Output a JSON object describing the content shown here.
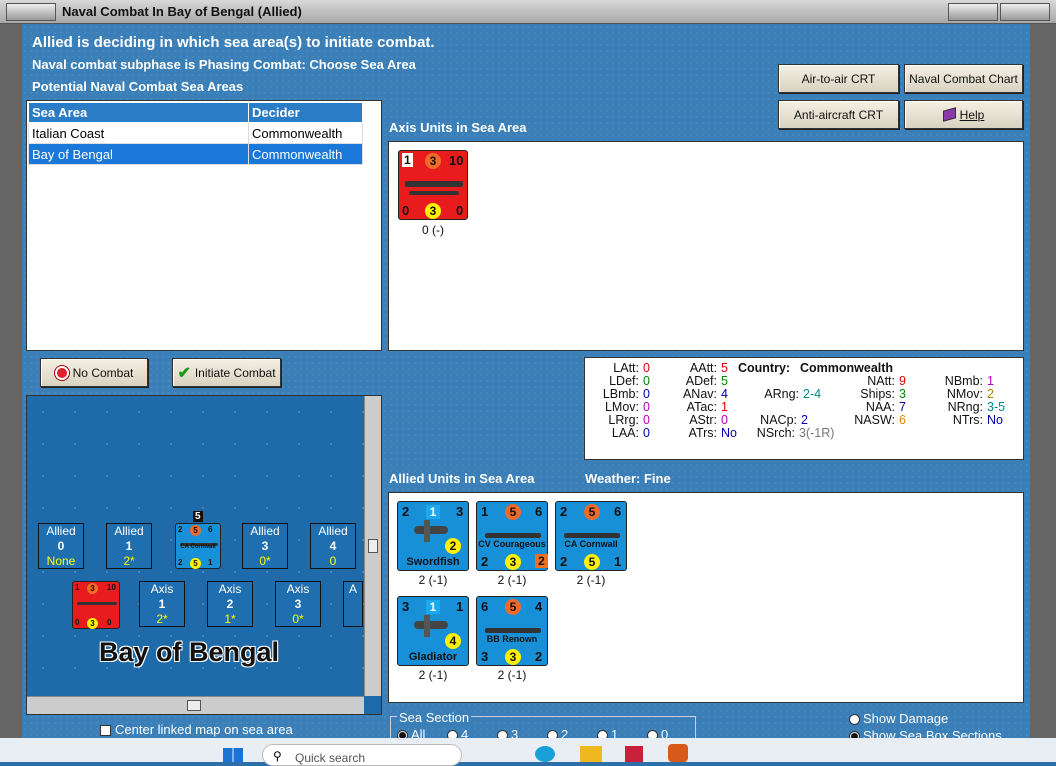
{
  "window": {
    "title": "Naval Combat In Bay of Bengal (Allied)"
  },
  "header": {
    "line1": "Allied is deciding in which sea area(s) to initiate combat.",
    "line2": "Naval combat subphase is Phasing Combat: Choose Sea Area",
    "line3": "Potential Naval Combat Sea Areas"
  },
  "buttons": {
    "air_to_air": "Air-to-air CRT",
    "naval_chart": "Naval Combat Chart",
    "anti_aircraft": "Anti-aircraft CRT",
    "help": "Help",
    "no_combat": "No Combat",
    "initiate_combat": "Initiate Combat"
  },
  "sea_table": {
    "headers": [
      "Sea Area",
      "Decider"
    ],
    "rows": [
      {
        "area": "Italian Coast",
        "decider": "Commonwealth"
      },
      {
        "area": "Bay of Bengal",
        "decider": "Commonwealth"
      }
    ]
  },
  "axis": {
    "title": "Axis Units in Sea Area",
    "unit": {
      "tl": "1",
      "circ": "3",
      "tr": "10",
      "bl": "0",
      "bc": "3",
      "br": "0",
      "label": "0 (-)"
    }
  },
  "stats": {
    "latt_l": "LAtt:",
    "latt": "0",
    "ldef_l": "LDef:",
    "ldef": "0",
    "lbmb_l": "LBmb:",
    "lbmb": "0",
    "lmov_l": "LMov:",
    "lmov": "0",
    "lrrg_l": "LRrg:",
    "lrrg": "0",
    "laa_l": "LAA:",
    "laa": "0",
    "aatt_l": "AAtt:",
    "aatt": "5",
    "adef_l": "ADef:",
    "adef": "5",
    "anav_l": "ANav:",
    "anav": "4",
    "atac_l": "ATac:",
    "atac": "1",
    "astr_l": "AStr:",
    "astr": "0",
    "atrs_l": "ATrs:",
    "atrs": "No",
    "country_l": "Country:",
    "country": "Commonwealth",
    "arng_l": "ARng:",
    "arng": "2-4",
    "nacp_l": "NACp:",
    "nacp": "2",
    "nsrch_l": "NSrch:",
    "nsrch": "3(-1R)",
    "natt_l": "NAtt:",
    "natt": "9",
    "ships_l": "Ships:",
    "ships": "3",
    "naa_l": "NAA:",
    "naa": "7",
    "nasw_l": "NASW:",
    "nasw": "6",
    "nbmb_l": "NBmb:",
    "nbmb": "1",
    "nmov_l": "NMov:",
    "nmov": "2",
    "nrng_l": "NRng:",
    "nrng": "3-5",
    "ntrs_l": "NTrs:",
    "ntrs": "No"
  },
  "allied": {
    "title": "Allied Units in Sea Area",
    "weather": "Weather:  Fine",
    "units": [
      {
        "tl": "2",
        "sq": "1",
        "tr": "3",
        "circ": "2",
        "name": "Swordfish",
        "label": "2 (-1)"
      },
      {
        "tl": "1",
        "circ": "5",
        "tr": "6",
        "name": "CV Courageous",
        "bl": "2",
        "bc": "3",
        "br": "2",
        "label": "2 (-1)"
      },
      {
        "tl": "2",
        "circ": "5",
        "tr": "6",
        "name": "CA Cornwall",
        "bl": "2",
        "bc": "5",
        "br": "1",
        "label": "2 (-1)"
      },
      {
        "tl": "3",
        "sq": "1",
        "tr": "1",
        "circ": "4",
        "name": "Gladiator",
        "label": "2 (-1)"
      },
      {
        "tl": "6",
        "circ": "5",
        "tr": "4",
        "name": "BB Renown",
        "bl": "3",
        "bc": "3",
        "br": "2",
        "label": "2 (-1)"
      }
    ]
  },
  "map": {
    "name": "Bay of Bengal",
    "stack": "5",
    "allied_boxes": [
      {
        "t": "Allied",
        "v": "0",
        "s": "None"
      },
      {
        "t": "Allied",
        "v": "1",
        "s": "2*"
      },
      {
        "t": "Allied",
        "v": "3",
        "s": "0*"
      },
      {
        "t": "Allied",
        "v": "4",
        "s": "0"
      }
    ],
    "axis_boxes": [
      {
        "t": "Axis",
        "v": "1",
        "s": "2*"
      },
      {
        "t": "Axis",
        "v": "2",
        "s": "1*"
      },
      {
        "t": "Axis",
        "v": "3",
        "s": "0*"
      },
      {
        "t": "A"
      }
    ],
    "mini_cornwall": {
      "tl": "2",
      "circ": "5",
      "tr": "6",
      "name": "CA Cornwall",
      "bl": "2",
      "bc": "5",
      "br": "1"
    },
    "mini_axis": {
      "tl": "1",
      "circ": "3",
      "tr": "10",
      "bl": "0",
      "bc": "3",
      "br": "0"
    }
  },
  "options": {
    "center_map": "Center linked map on sea area",
    "sea_section": "Sea Section",
    "sections": [
      "All",
      "4",
      "3",
      "2",
      "1",
      "0"
    ],
    "show_damage": "Show Damage",
    "show_sections": "Show Sea Box Sections"
  },
  "taskbar": {
    "search": "Quick search"
  }
}
